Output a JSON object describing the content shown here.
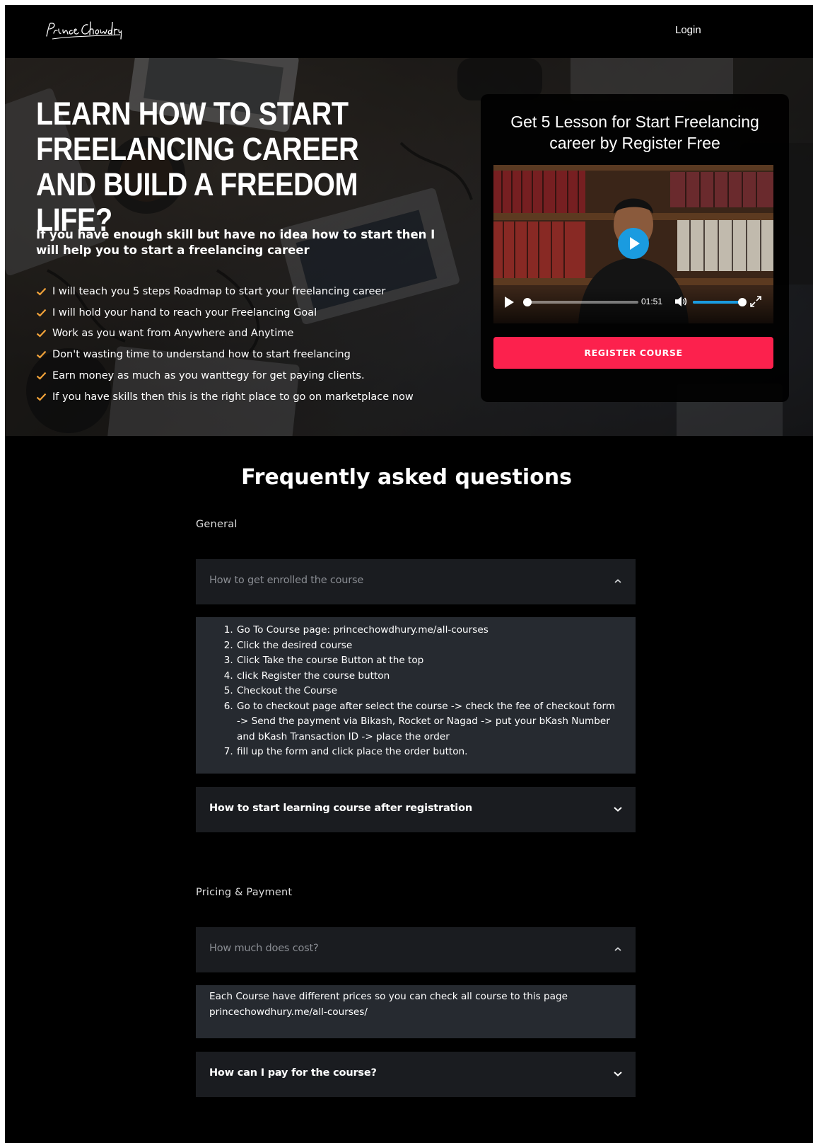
{
  "header": {
    "logo_text": "Prince Chowdhury",
    "login_label": "Login"
  },
  "hero": {
    "title": "Learn how to start freelancing career and build a freedom life?",
    "subtitle": "If you have enough skill but have no idea how to start then I will help you to start a freelancing career",
    "checklist": [
      "I will teach you 5 steps Roadmap to start your freelancing career",
      "I will hold your hand to reach your Freelancing Goal",
      "Work as you want from Anywhere and Anytime",
      "Don't wasting time to understand how to start freelancing",
      "Earn money as much as you wanttegy for get paying clients.",
      "If you have skills then this is the right place to go on marketplace now"
    ],
    "check_icon": "check-icon",
    "accent_color": "#f2a33a"
  },
  "register_card": {
    "title": "Get 5 Lesson for Start Freelancing career by Register Free",
    "video": {
      "time": "01:51",
      "progress": 0.0,
      "volume": 1.0
    },
    "button_label": "REGISTER COURSE",
    "button_color": "#fc214d"
  },
  "faq": {
    "title": "Frequently asked questions",
    "sections": [
      {
        "title": "General",
        "items": [
          {
            "question": "How to get enrolled the course",
            "expanded": true,
            "answer_steps": [
              "Go To Course page: princechowdhury.me/all-courses",
              "Click the desired course",
              "Click Take the course Button at the top",
              "click Register the course button",
              "Checkout the Course",
              "Go to checkout page after select the course -> check the fee of checkout form -> Send the payment via Bikash, Rocket or Nagad -> put your bKash Number and bKash Transaction ID -> place the order",
              "fill up the form and click place the order button."
            ]
          },
          {
            "question": "How to start learning course after registration",
            "expanded": false
          }
        ]
      },
      {
        "title": "Pricing & Payment",
        "items": [
          {
            "question": "How much does cost?",
            "expanded": true,
            "answer": "Each Course have different prices so you can check all course to this page princechowdhury.me/all-courses/"
          },
          {
            "question": "How can I pay for the course?",
            "expanded": false
          }
        ]
      }
    ]
  }
}
